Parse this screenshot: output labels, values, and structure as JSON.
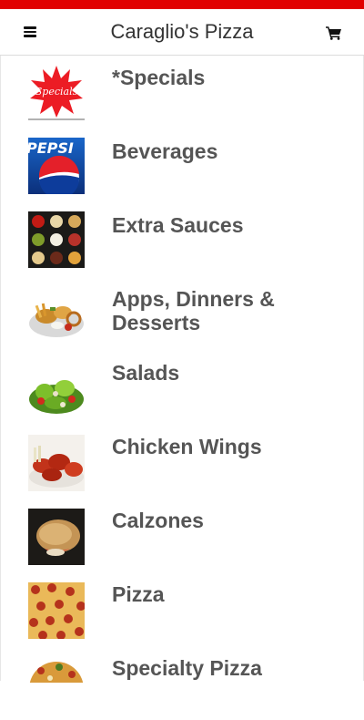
{
  "header": {
    "title": "Caraglio's Pizza",
    "menu_icon": "hamburger-menu-icon",
    "cart_icon": "shopping-cart-icon"
  },
  "colors": {
    "accent": "#e10000",
    "text": "#555555",
    "title": "#333333"
  },
  "categories": [
    {
      "label": "*Specials",
      "thumb": "specials-starburst-image",
      "thumb_text": "Specials"
    },
    {
      "label": "Beverages",
      "thumb": "pepsi-logo-image",
      "thumb_text": "PEPSI"
    },
    {
      "label": "Extra Sauces",
      "thumb": "sauce-cups-image"
    },
    {
      "label": "Apps, Dinners & Desserts",
      "thumb": "appetizer-platter-image"
    },
    {
      "label": "Salads",
      "thumb": "salad-image"
    },
    {
      "label": "Chicken Wings",
      "thumb": "chicken-wings-image"
    },
    {
      "label": "Calzones",
      "thumb": "calzone-image"
    },
    {
      "label": "Pizza",
      "thumb": "pepperoni-pizza-image"
    },
    {
      "label": "Specialty Pizza",
      "thumb": "specialty-pizza-image"
    }
  ]
}
